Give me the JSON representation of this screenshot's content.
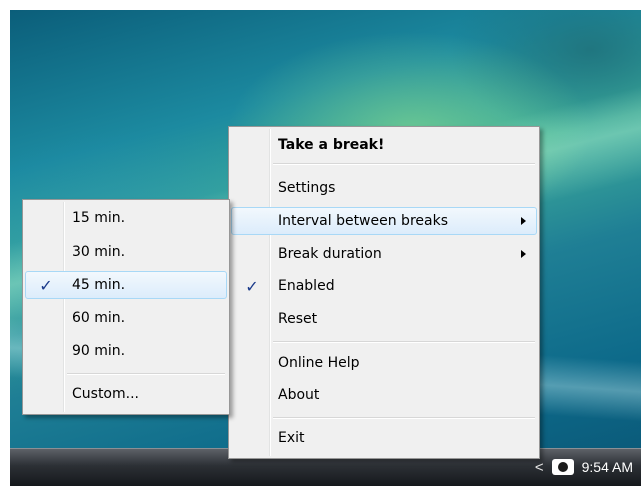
{
  "context_menu": {
    "items": [
      {
        "label": "Take a break!",
        "bold": true
      },
      {
        "label": "Settings"
      },
      {
        "label": "Interval between breaks",
        "has_submenu": true,
        "highlighted": true
      },
      {
        "label": "Break duration",
        "has_submenu": true
      },
      {
        "label": "Enabled",
        "checked": true
      },
      {
        "label": "Reset"
      },
      {
        "label": "Online Help"
      },
      {
        "label": "About"
      },
      {
        "label": "Exit"
      }
    ]
  },
  "interval_submenu": {
    "items": [
      {
        "label": "15 min."
      },
      {
        "label": "30 min."
      },
      {
        "label": "45 min.",
        "checked": true,
        "highlighted": true
      },
      {
        "label": "60 min."
      },
      {
        "label": "90 min."
      },
      {
        "label": "Custom..."
      }
    ]
  },
  "check_glyph": "✓",
  "taskbar": {
    "tray_chevron": "<",
    "clock": "9:54 AM",
    "tray_icon": "eye-icon"
  },
  "colors": {
    "menu_bg": "#f0f0f0",
    "highlight_border": "#a8d8f6",
    "check_color": "#1a3a8a"
  }
}
